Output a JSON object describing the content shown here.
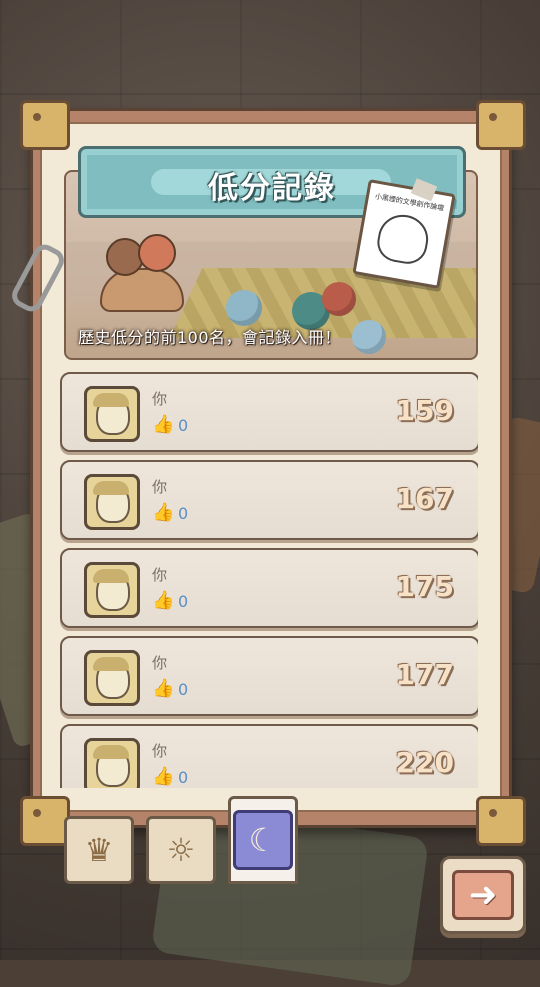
{
  "title": "低分記錄",
  "banner": {
    "caption": "歷史低分的前100名，會記錄入冊！",
    "note_text": "小黑煙的文學創作論壇"
  },
  "records": [
    {
      "name": "你",
      "likes": "0",
      "score": "159",
      "like_icon": "thumbs-up-icon",
      "avatar_icon": "player-avatar-icon"
    },
    {
      "name": "你",
      "likes": "0",
      "score": "167",
      "like_icon": "thumbs-up-icon",
      "avatar_icon": "player-avatar-icon"
    },
    {
      "name": "你",
      "likes": "0",
      "score": "175",
      "like_icon": "thumbs-up-icon",
      "avatar_icon": "player-avatar-icon"
    },
    {
      "name": "你",
      "likes": "0",
      "score": "177",
      "like_icon": "thumbs-up-icon",
      "avatar_icon": "player-avatar-icon"
    },
    {
      "name": "你",
      "likes": "0",
      "score": "220",
      "like_icon": "thumbs-up-icon",
      "avatar_icon": "player-avatar-icon"
    }
  ],
  "tabs": [
    {
      "icon": "crown-icon",
      "selected": false
    },
    {
      "icon": "sun-face-icon",
      "selected": false
    },
    {
      "icon": "moon-face-icon",
      "selected": true
    }
  ],
  "next_button": {
    "icon": "right-arrow-icon"
  },
  "colors": {
    "title_bg": "#7fbdc0",
    "score_text": "#f7e2c7",
    "like_count": "#5a8fc8",
    "selected_tab": "#8b8ad4"
  }
}
